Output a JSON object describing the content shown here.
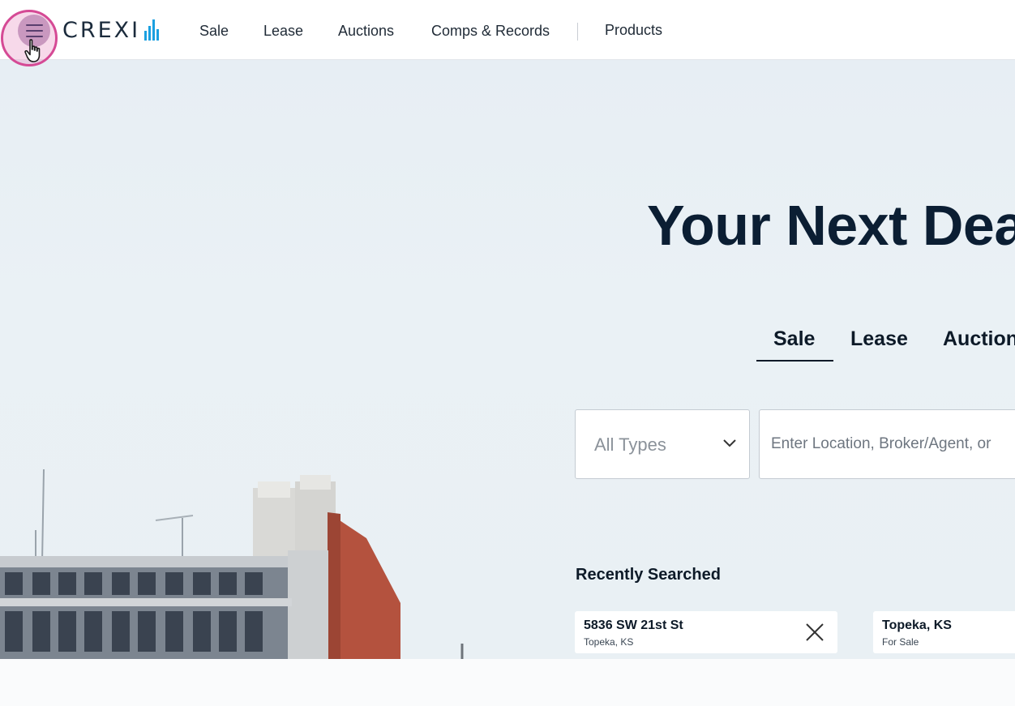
{
  "header": {
    "logo_text": "CREXI",
    "nav": [
      "Sale",
      "Lease",
      "Auctions",
      "Comps & Records",
      "Products"
    ]
  },
  "hero": {
    "title": "Your Next Dea",
    "tabs": [
      "Sale",
      "Lease",
      "Auction"
    ],
    "active_tab": "Sale",
    "type_select": {
      "value": "All Types"
    },
    "search": {
      "placeholder": "Enter Location, Broker/Agent, or"
    },
    "recent": {
      "title": "Recently Searched",
      "items": [
        {
          "primary": "5836 SW 21st St",
          "secondary": "Topeka, KS"
        },
        {
          "primary": "Topeka, KS",
          "secondary": "For Sale"
        }
      ]
    }
  },
  "colors": {
    "brand_blue": "#1aa0e0",
    "navy": "#0b1e33",
    "highlight_pink": "#d54a95"
  }
}
